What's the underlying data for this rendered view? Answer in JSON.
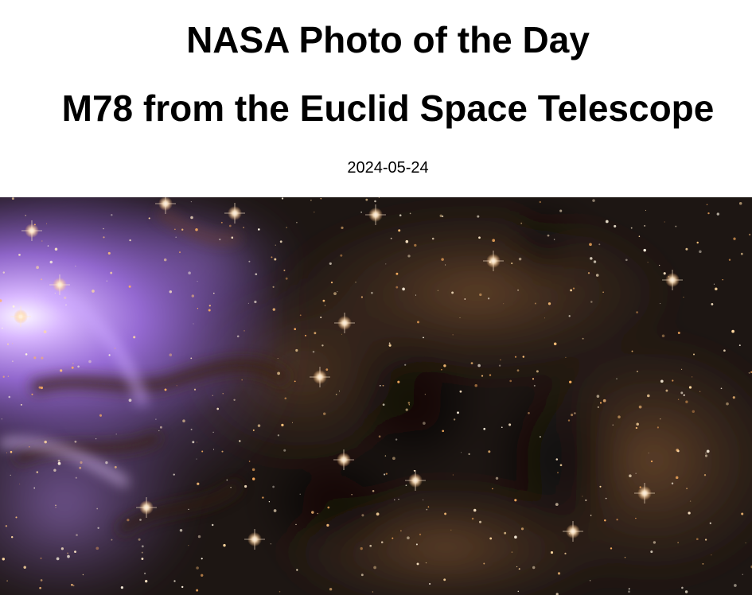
{
  "header": {
    "site_title": "NASA Photo of the Day",
    "photo_title": "M78 from the Euclid Space Telescope",
    "date": "2024-05-24"
  },
  "image": {
    "subject": "nebula-photo",
    "colors": {
      "background": "#1b1512",
      "nebula_violet": "#b48cff",
      "nebula_core": "#f4ecff",
      "dust_brown": "#5a3a22",
      "dust_orange": "#8a5a2c",
      "star_warm": "#ffd9a0"
    }
  }
}
